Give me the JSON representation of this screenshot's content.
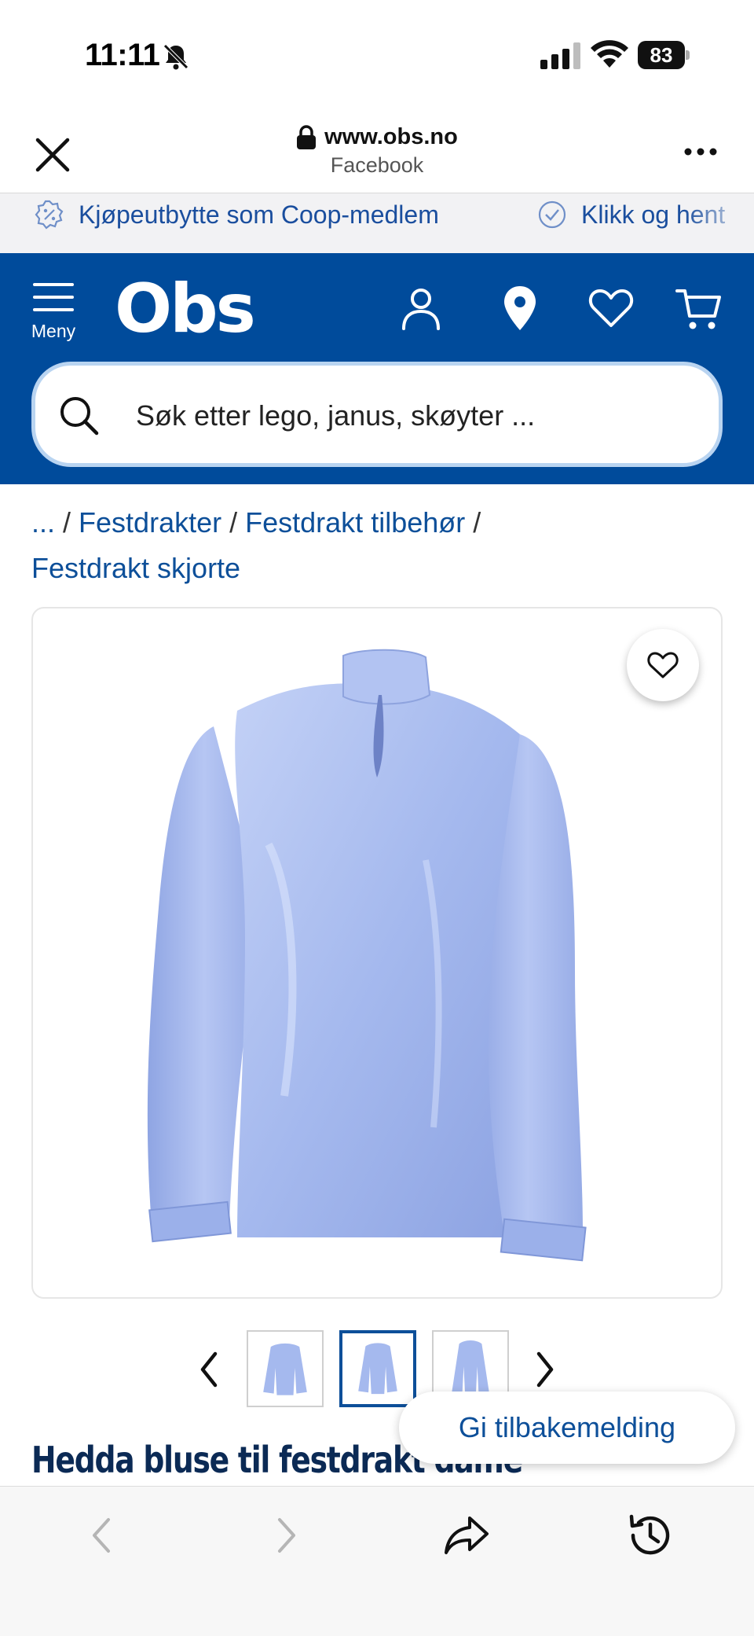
{
  "status_bar": {
    "time": "11:11",
    "battery": "83"
  },
  "browser": {
    "url": "www.obs.no",
    "source": "Facebook"
  },
  "promo": {
    "items": [
      {
        "icon": "percent-badge-icon",
        "text": "Kjøpeutbytte som Coop-medlem"
      },
      {
        "icon": "check-badge-icon",
        "text": "Klikk og hent"
      }
    ]
  },
  "header": {
    "menu_label": "Meny",
    "logo": "Obs",
    "search_placeholder": "Søk etter lego, janus, skøyter ..."
  },
  "breadcrumb": [
    {
      "label": "..."
    },
    {
      "label": "Festdrakter"
    },
    {
      "label": "Festdrakt tilbehør"
    },
    {
      "label": "Festdrakt skjorte"
    }
  ],
  "product": {
    "title": "Hedda bluse til festdrakt dame",
    "image_color": "#a9bcf0",
    "thumbnail_count": 3,
    "active_thumbnail": 2
  },
  "feedback_label": "Gi tilbakemelding",
  "colors": {
    "brand_blue": "#004b9b",
    "link_blue": "#0d4f99"
  }
}
